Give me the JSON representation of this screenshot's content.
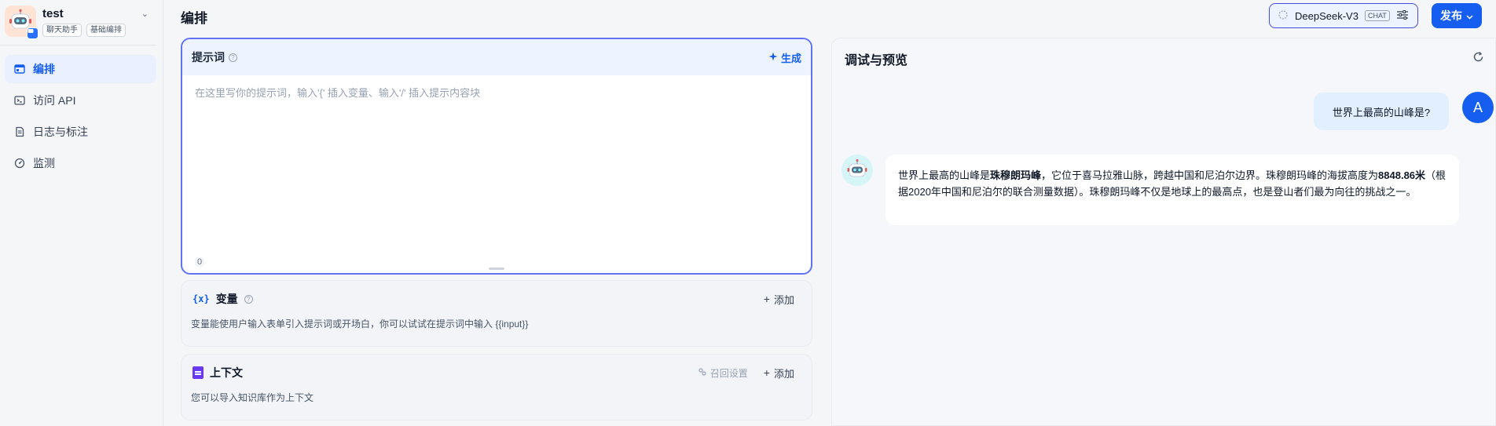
{
  "app": {
    "name": "test",
    "tags": [
      "聊天助手",
      "基础编排"
    ]
  },
  "nav": [
    {
      "label": "编排",
      "icon": "layout-icon",
      "active": true
    },
    {
      "label": "访问 API",
      "icon": "terminal-icon",
      "active": false
    },
    {
      "label": "日志与标注",
      "icon": "document-list-icon",
      "active": false
    },
    {
      "label": "监测",
      "icon": "gauge-icon",
      "active": false
    }
  ],
  "header": {
    "title": "编排",
    "model": {
      "name": "DeepSeek-V3",
      "mode": "CHAT"
    },
    "publish_label": "发布"
  },
  "prompt": {
    "label": "提示词",
    "generate_label": "生成",
    "placeholder": "在这里写你的提示词，输入'{' 插入变量、输入'/' 插入提示内容块",
    "char_count": "0"
  },
  "variables": {
    "label": "变量",
    "icon_text": "{x}",
    "add_label": "添加",
    "description": "变量能使用户输入表单引入提示词或开场白，你可以试试在提示词中输入 {{input}}"
  },
  "context": {
    "label": "上下文",
    "recall_label": "召回设置",
    "add_label": "添加",
    "description": "您可以导入知识库作为上下文"
  },
  "debug": {
    "title": "调试与预览",
    "user_avatar_letter": "A",
    "user_message": "世界上最高的山峰是?",
    "answer": {
      "p1": "世界上最高的山峰是",
      "b1": "珠穆朗玛峰",
      "p2": "，它位于喜马拉雅山脉，跨越中国和尼泊尔边界。珠穆朗玛峰的海拔高度为",
      "b2": "8848.86米",
      "p3": "（根据2020年中国和尼泊尔的联合测量数据）。珠穆朗玛峰不仅是地球上的最高点，也是登山者们最为向往的挑战之一。"
    }
  },
  "colors": {
    "accent": "#155eef",
    "prompt_border": "#6172f3",
    "context_icon": "#6938ef"
  }
}
